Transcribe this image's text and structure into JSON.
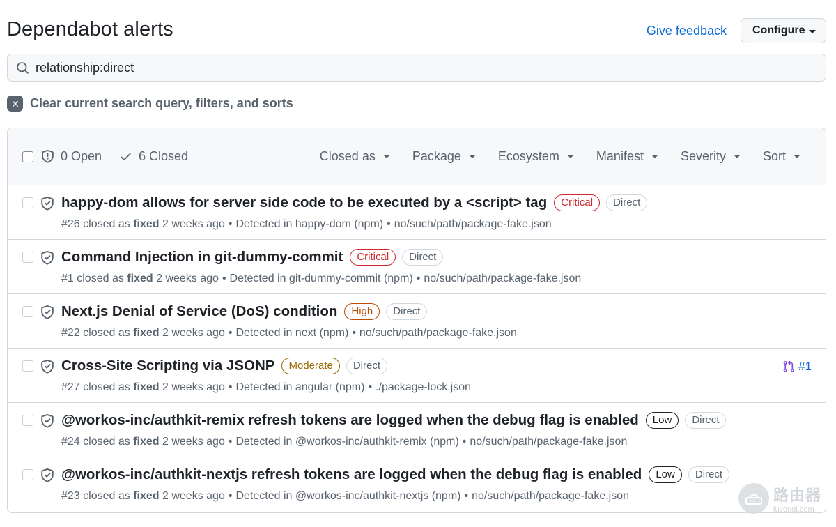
{
  "header": {
    "title": "Dependabot alerts",
    "feedback_label": "Give feedback",
    "configure_label": "Configure"
  },
  "search": {
    "value": "relationship:direct",
    "icon": "search-icon"
  },
  "clear": {
    "label": "Clear current search query, filters, and sorts",
    "icon": "x-icon"
  },
  "list_header": {
    "open_label": "0 Open",
    "closed_label": "6 Closed",
    "filters": [
      "Closed as",
      "Package",
      "Ecosystem",
      "Manifest",
      "Severity",
      "Sort"
    ]
  },
  "alerts": [
    {
      "title": "happy-dom allows for server side code to be executed by a <script> tag",
      "severity": "Critical",
      "severity_class": "critical",
      "relationship": "Direct",
      "number": "#26",
      "closed_text": "closed as",
      "closed_reason": "fixed",
      "time": "2 weeks ago",
      "detected": "Detected in happy-dom (npm)",
      "manifest": "no/such/path/package-fake.json",
      "linked_pr": ""
    },
    {
      "title": "Command Injection in git-dummy-commit",
      "severity": "Critical",
      "severity_class": "critical",
      "relationship": "Direct",
      "number": "#1",
      "closed_text": "closed as",
      "closed_reason": "fixed",
      "time": "2 weeks ago",
      "detected": "Detected in git-dummy-commit (npm)",
      "manifest": "no/such/path/package-fake.json",
      "linked_pr": ""
    },
    {
      "title": "Next.js Denial of Service (DoS) condition",
      "severity": "High",
      "severity_class": "high",
      "relationship": "Direct",
      "number": "#22",
      "closed_text": "closed as",
      "closed_reason": "fixed",
      "time": "2 weeks ago",
      "detected": "Detected in next (npm)",
      "manifest": "no/such/path/package-fake.json",
      "linked_pr": ""
    },
    {
      "title": "Cross-Site Scripting via JSONP",
      "severity": "Moderate",
      "severity_class": "moderate",
      "relationship": "Direct",
      "number": "#27",
      "closed_text": "closed as",
      "closed_reason": "fixed",
      "time": "2 weeks ago",
      "detected": "Detected in angular (npm)",
      "manifest": "./package-lock.json",
      "linked_pr": "#1"
    },
    {
      "title": "@workos-inc/authkit-remix refresh tokens are logged when the debug flag is enabled",
      "severity": "Low",
      "severity_class": "low",
      "relationship": "Direct",
      "number": "#24",
      "closed_text": "closed as",
      "closed_reason": "fixed",
      "time": "2 weeks ago",
      "detected": "Detected in @workos-inc/authkit-remix (npm)",
      "manifest": "no/such/path/package-fake.json",
      "linked_pr": ""
    },
    {
      "title": "@workos-inc/authkit-nextjs refresh tokens are logged when the debug flag is enabled",
      "severity": "Low",
      "severity_class": "low",
      "relationship": "Direct",
      "number": "#23",
      "closed_text": "closed as",
      "closed_reason": "fixed",
      "time": "2 weeks ago",
      "detected": "Detected in @workos-inc/authkit-nextjs (npm)",
      "manifest": "no/such/path/package-fake.json",
      "linked_pr": ""
    }
  ],
  "watermark": {
    "cn": "路由器",
    "url": "luyouqi.com"
  },
  "colors": {
    "link": "#0969da",
    "critical": "#d1242f",
    "high": "#bc4c00",
    "moderate": "#9a6700",
    "muted": "#59636e",
    "pr_icon": "#8250df"
  }
}
